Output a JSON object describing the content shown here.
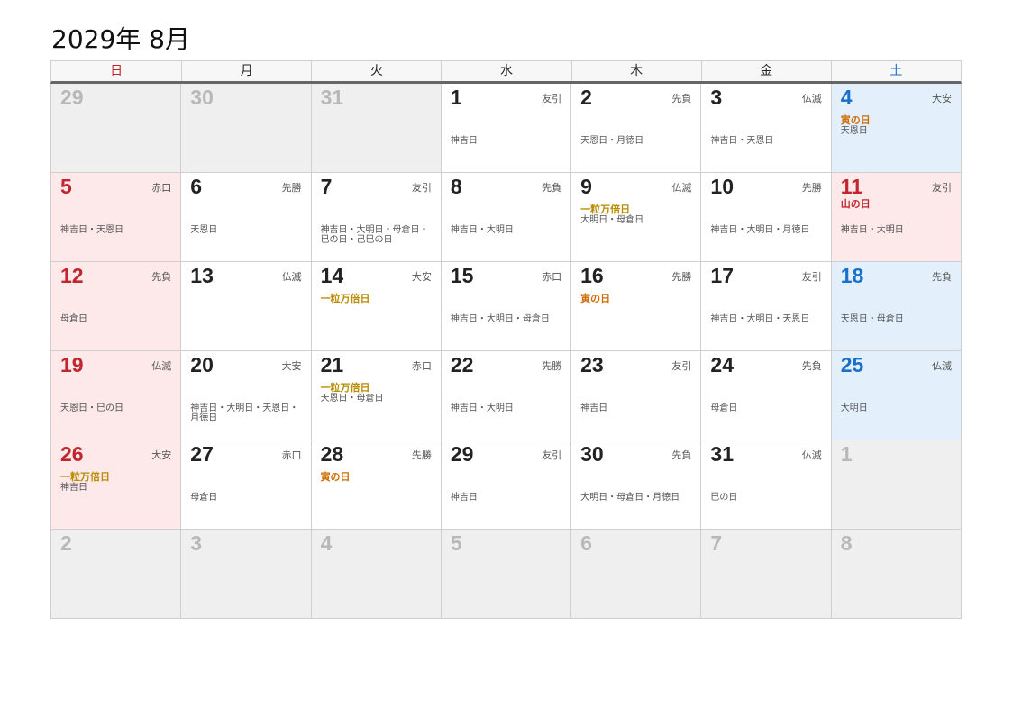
{
  "title": "2029年 8月",
  "weekdays": [
    {
      "label": "日",
      "cls": "sun"
    },
    {
      "label": "月",
      "cls": ""
    },
    {
      "label": "火",
      "cls": ""
    },
    {
      "label": "水",
      "cls": ""
    },
    {
      "label": "木",
      "cls": ""
    },
    {
      "label": "金",
      "cls": ""
    },
    {
      "label": "土",
      "cls": "sat"
    }
  ],
  "days": [
    {
      "n": "29",
      "type": "other"
    },
    {
      "n": "30",
      "type": "other"
    },
    {
      "n": "31",
      "type": "other"
    },
    {
      "n": "1",
      "type": "",
      "rokuyo": "友引",
      "notes": "神吉日"
    },
    {
      "n": "2",
      "type": "",
      "rokuyo": "先負",
      "notes": "天恩日・月徳日"
    },
    {
      "n": "3",
      "type": "",
      "rokuyo": "仏滅",
      "notes": "神吉日・天恩日"
    },
    {
      "n": "4",
      "type": "sat",
      "rokuyo": "大安",
      "special": "寅の日",
      "specialType": "tora",
      "notes": "天恩日"
    },
    {
      "n": "5",
      "type": "sun",
      "rokuyo": "赤口",
      "notes": "神吉日・天恩日"
    },
    {
      "n": "6",
      "type": "",
      "rokuyo": "先勝",
      "notes": "天恩日"
    },
    {
      "n": "7",
      "type": "",
      "rokuyo": "友引",
      "notes": "神吉日・大明日・母倉日・巳の日・己巳の日"
    },
    {
      "n": "8",
      "type": "",
      "rokuyo": "先負",
      "notes": "神吉日・大明日"
    },
    {
      "n": "9",
      "type": "",
      "rokuyo": "仏滅",
      "special": "一粒万倍日",
      "specialType": "ichi",
      "notes": "大明日・母倉日"
    },
    {
      "n": "10",
      "type": "",
      "rokuyo": "先勝",
      "notes": "神吉日・大明日・月徳日"
    },
    {
      "n": "11",
      "type": "sun",
      "rokuyo": "友引",
      "special": "山の日",
      "specialType": "yama",
      "notes": "神吉日・大明日",
      "firstRowHoliday": true
    },
    {
      "n": "12",
      "type": "sun",
      "rokuyo": "先負",
      "notes": "母倉日"
    },
    {
      "n": "13",
      "type": "",
      "rokuyo": "仏滅",
      "notes": ""
    },
    {
      "n": "14",
      "type": "",
      "rokuyo": "大安",
      "special": "一粒万倍日",
      "specialType": "ichi",
      "notes": ""
    },
    {
      "n": "15",
      "type": "",
      "rokuyo": "赤口",
      "notes": "神吉日・大明日・母倉日"
    },
    {
      "n": "16",
      "type": "",
      "rokuyo": "先勝",
      "special": "寅の日",
      "specialType": "tora",
      "notes": ""
    },
    {
      "n": "17",
      "type": "",
      "rokuyo": "友引",
      "notes": "神吉日・大明日・天恩日"
    },
    {
      "n": "18",
      "type": "sat",
      "rokuyo": "先負",
      "notes": "天恩日・母倉日"
    },
    {
      "n": "19",
      "type": "sun",
      "rokuyo": "仏滅",
      "notes": "天恩日・巳の日"
    },
    {
      "n": "20",
      "type": "",
      "rokuyo": "大安",
      "notes": "神吉日・大明日・天恩日・月徳日"
    },
    {
      "n": "21",
      "type": "",
      "rokuyo": "赤口",
      "special": "一粒万倍日",
      "specialType": "ichi",
      "notes": "天恩日・母倉日"
    },
    {
      "n": "22",
      "type": "",
      "rokuyo": "先勝",
      "notes": "神吉日・大明日"
    },
    {
      "n": "23",
      "type": "",
      "rokuyo": "友引",
      "notes": "神吉日"
    },
    {
      "n": "24",
      "type": "",
      "rokuyo": "先負",
      "notes": "母倉日"
    },
    {
      "n": "25",
      "type": "sat",
      "rokuyo": "仏滅",
      "notes": "大明日"
    },
    {
      "n": "26",
      "type": "sun",
      "rokuyo": "大安",
      "special": "一粒万倍日",
      "specialType": "ichi",
      "notes": "神吉日"
    },
    {
      "n": "27",
      "type": "",
      "rokuyo": "赤口",
      "notes": "母倉日"
    },
    {
      "n": "28",
      "type": "",
      "rokuyo": "先勝",
      "special": "寅の日",
      "specialType": "tora",
      "notes": ""
    },
    {
      "n": "29",
      "type": "",
      "rokuyo": "友引",
      "notes": "神吉日"
    },
    {
      "n": "30",
      "type": "",
      "rokuyo": "先負",
      "notes": "大明日・母倉日・月徳日"
    },
    {
      "n": "31",
      "type": "",
      "rokuyo": "仏滅",
      "notes": "巳の日"
    },
    {
      "n": "1",
      "type": "other"
    },
    {
      "n": "2",
      "type": "other"
    },
    {
      "n": "3",
      "type": "other"
    },
    {
      "n": "4",
      "type": "other"
    },
    {
      "n": "5",
      "type": "other"
    },
    {
      "n": "6",
      "type": "other"
    },
    {
      "n": "7",
      "type": "other"
    },
    {
      "n": "8",
      "type": "other"
    }
  ]
}
